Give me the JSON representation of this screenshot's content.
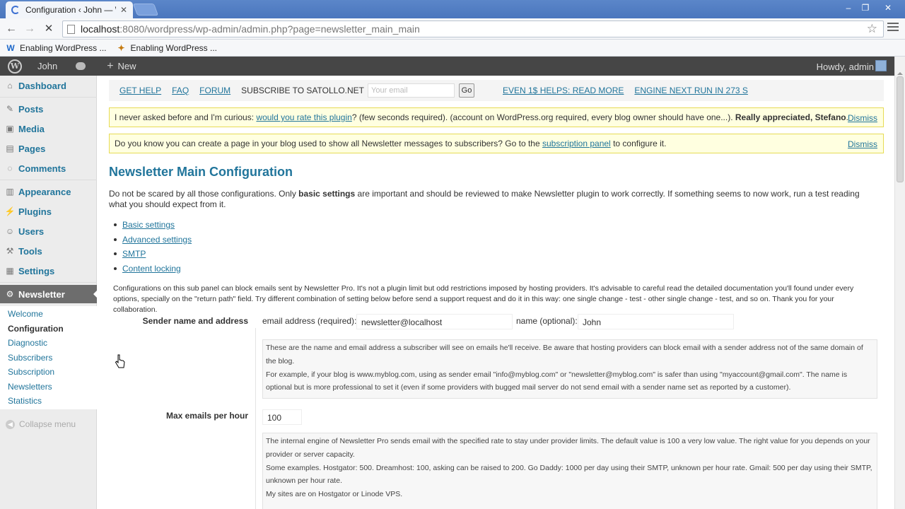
{
  "browser": {
    "tab_title": "Configuration ‹ John — W",
    "url_host": "localhost",
    "url_rest": ":8080/wordpress/wp-admin/admin.php?page=newsletter_main_main",
    "bookmarks": [
      "Enabling WordPress ...",
      "Enabling WordPress ..."
    ]
  },
  "adminbar": {
    "site": "John",
    "new_label": "New",
    "howdy": "Howdy, admin"
  },
  "sidebar": {
    "items": [
      "Dashboard",
      "Posts",
      "Media",
      "Pages",
      "Comments",
      "Appearance",
      "Plugins",
      "Users",
      "Tools",
      "Settings",
      "Newsletter"
    ],
    "submenu": [
      "Welcome",
      "Configuration",
      "Diagnostic",
      "Subscribers",
      "Subscription",
      "Newsletters",
      "Statistics"
    ],
    "collapse": "Collapse menu"
  },
  "topbar": {
    "get_help": "GET HELP",
    "faq": "FAQ",
    "forum": "FORUM",
    "subscribe": "SUBSCRIBE TO SATOLLO.NET",
    "email_placeholder": "Your email",
    "go": "Go",
    "helps": "EVEN 1$ HELPS: READ MORE",
    "engine": "ENGINE NEXT RUN IN 273 S"
  },
  "notices": {
    "rate_pre": "I never asked before and I'm curious: ",
    "rate_link": "would you rate this plugin",
    "rate_post": "? (few seconds required). (account on WordPress.org required, every blog owner should have one...). ",
    "rate_bold": "Really appreciated, Stefano",
    "rate_end": ".",
    "page_pre": "Do you know you can create a page in your blog used to show all Newsletter messages to subscribers? Go to the ",
    "page_link": "subscription panel",
    "page_post": " to configure it.",
    "dismiss": "Dismiss"
  },
  "main": {
    "title": "Newsletter Main Configuration",
    "intro_pre": "Do not be scared by all those configurations. Only ",
    "intro_bold": "basic settings",
    "intro_post": " are important and should be reviewed to make Newsletter plugin to work correctly. If something seems to now work, run a test reading what you should expect from it.",
    "toc": [
      "Basic settings",
      "Advanced settings",
      "SMTP",
      "Content locking"
    ],
    "warning": "Configurations on this sub panel can block emails sent by Newsletter Pro. It's not a plugin limit but odd restrictions imposed by hosting providers. It's advisable to careful read the detailed documentation you'll found under every options, specially on the \"return path\" field. Try different combination of setting below before send a support request and do it in this way: one single change - test - other single change - test, and so on. Thank you for your collaboration."
  },
  "sender": {
    "label": "Sender name and address",
    "email_label": "email address (required):",
    "email_value": "newsletter@localhost",
    "name_label": "name (optional):",
    "name_value": "John",
    "hint_1": "These are the name and email address a subscriber will see on emails he'll receive. Be aware that hosting providers can block email with a sender address not of the same domain of the blog.",
    "hint_2": "For example, if your blog is www.myblog.com, using as sender email \"info@myblog.com\" or \"newsletter@myblog.com\" is safer than using \"myaccount@gmail.com\". The name is optional but is more professional to set it (even if some providers with bugged mail server do not send email with a sender name set as reported by a customer)."
  },
  "max_emails": {
    "label": "Max emails per hour",
    "value": "100",
    "hint_1": "The internal engine of Newsletter Pro sends email with the specified rate to stay under provider limits. The default value is 100 a very low value. The right value for you depends on your provider or server capacity.",
    "hint_2": "Some examples. Hostgator: 500. Dreamhost: 100, asking can be raised to 200. Go Daddy: 1000 per day using their SMTP, unknown per hour rate. Gmail: 500 per day using their SMTP, unknown per hour rate.",
    "hint_3": "My sites are on Hostgator or Linode VPS."
  }
}
